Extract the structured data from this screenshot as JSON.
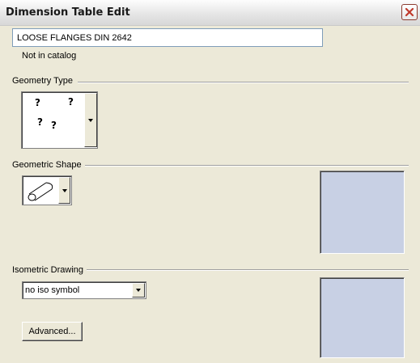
{
  "window": {
    "title": "Dimension Table Edit",
    "close_icon": "close-icon"
  },
  "name_field": {
    "value": "LOOSE FLANGES DIN 2642"
  },
  "catalog_status": "Not in catalog",
  "geometry_type": {
    "label": "Geometry Type",
    "unknown_symbols": [
      "?",
      "?",
      "?",
      "?"
    ]
  },
  "geometric_shape": {
    "label": "Geometric Shape",
    "selected_icon": "cylinder-icon"
  },
  "isometric_drawing": {
    "label": "Isometric Drawing",
    "selected": "no iso symbol"
  },
  "advanced_button": {
    "label": "Advanced..."
  },
  "colors": {
    "preview_bg": "#c8d0e4",
    "dialog_bg": "#ece9d8",
    "close_border": "#8d3c30",
    "close_x": "#c0392b"
  }
}
